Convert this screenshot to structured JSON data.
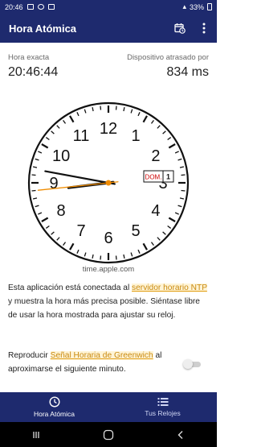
{
  "status_bar": {
    "time": "20:46",
    "battery": "33%"
  },
  "app_bar": {
    "title": "Hora Atómica",
    "calendar_icon": "calendar-clock-icon",
    "menu_icon": "more-vert-icon"
  },
  "info": {
    "left_label": "Hora exacta",
    "left_value": "20:46:44",
    "right_label": "Dispositivo atrasado por",
    "right_value": "834 ms"
  },
  "clock": {
    "numbers": [
      "12",
      "1",
      "2",
      "3",
      "4",
      "5",
      "6",
      "7",
      "8",
      "9",
      "10",
      "11"
    ],
    "hours": 20,
    "minutes": 46,
    "seconds": 44,
    "date_day_label": "DOM.",
    "date_day_number": "1",
    "colors": {
      "face": "#ffffff",
      "ticks": "#111111",
      "hands": "#111111",
      "second_hand": "#f08c00",
      "date_label": "#cc0000"
    }
  },
  "server": "time.apple.com",
  "description": {
    "text_before": "Esta aplicación está conectada al ",
    "link": "servidor horario NTP",
    "text_after": " y muestra la hora más precisa posible. Siéntase libre de usar la hora mostrada para ajustar su reloj."
  },
  "greenwich": {
    "text_before": "Reproducir ",
    "link": "Señal Horaria de Greenwich",
    "text_after": " al aproximarse el siguiente minuto.",
    "enabled": false
  },
  "bottom_nav": {
    "items": [
      {
        "label": "Hora Atómica",
        "icon": "clock-icon",
        "active": true
      },
      {
        "label": "Tus Relojes",
        "icon": "list-icon",
        "active": false
      }
    ]
  },
  "system_nav": {
    "recents": "recents-icon",
    "home": "home-icon",
    "back": "back-icon"
  }
}
